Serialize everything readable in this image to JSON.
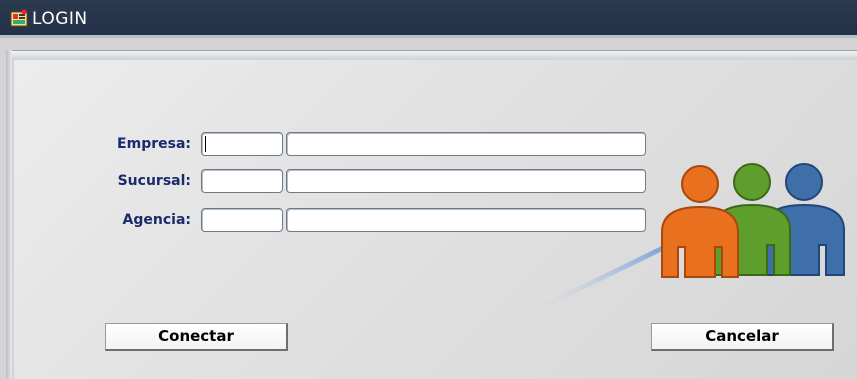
{
  "window": {
    "title": "LOGIN",
    "icon": "app-icon"
  },
  "form": {
    "fields": [
      {
        "label": "Empresa:",
        "code_value": "",
        "name_value": ""
      },
      {
        "label": "Sucursal:",
        "code_value": "",
        "name_value": ""
      },
      {
        "label": "Agencia:",
        "code_value": "",
        "name_value": ""
      }
    ],
    "focused_field": "Empresa code"
  },
  "buttons": {
    "connect_label": "Conectar",
    "cancel_label": "Cancelar"
  },
  "colors": {
    "titlebar": "#23314a",
    "label_text": "#1a2a6c",
    "person_orange": "#e8701e",
    "person_green": "#5e9e2c",
    "person_blue": "#3f6fa8"
  },
  "illustration": "people-group-icon"
}
